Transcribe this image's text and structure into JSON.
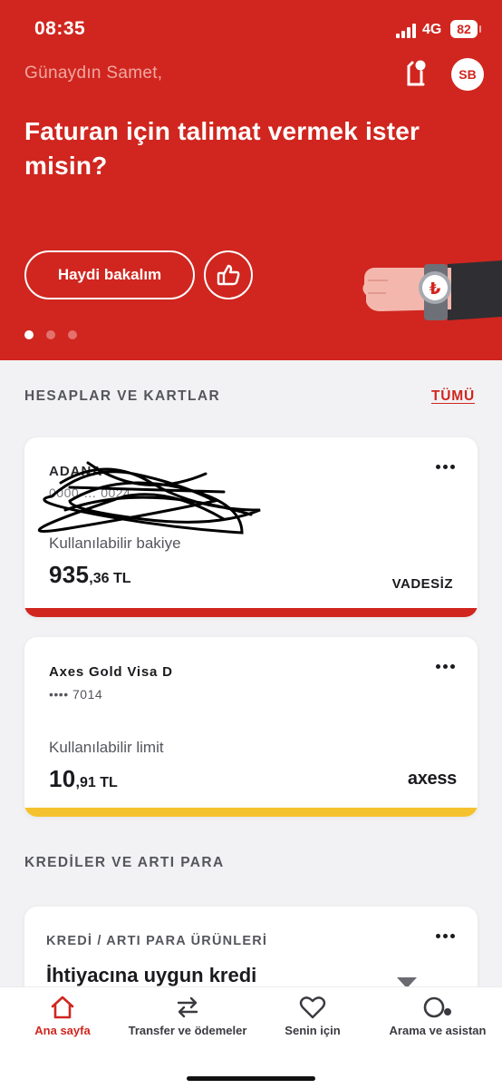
{
  "status_bar": {
    "time": "08:35",
    "network": "4G",
    "battery": "82"
  },
  "hero": {
    "greeting": "Günaydın Samet,",
    "avatar_initials": "SB",
    "headline": "Faturan için talimat vermek ister misin?",
    "cta_label": "Haydi bakalım",
    "carousel": {
      "count": 3,
      "active_index": 0
    }
  },
  "accounts_section": {
    "title": "HESAPLAR VE KARTLAR",
    "see_all": "TÜMÜ",
    "account": {
      "name": "ADANA",
      "number": "0000-… 0024",
      "balance_label": "Kullanılabilir bakiye",
      "balance_whole": "935",
      "balance_fraction": ",36 TL",
      "type": "VADESİZ",
      "accent_color": "#d0261f"
    },
    "card": {
      "name": "Axes Gold Visa D",
      "number": "•••• 7014",
      "limit_label": "Kullanılabilir limit",
      "limit_whole": "10",
      "limit_fraction": ",91 TL",
      "brand": "axess",
      "accent_color": "#f5c22f"
    }
  },
  "credits_section": {
    "title": "KREDİLER VE ARTI PARA",
    "card": {
      "subtitle": "KREDİ / ARTI PARA ÜRÜNLERİ",
      "title": "İhtiyacına uygun kredi"
    }
  },
  "tabbar": {
    "tabs": [
      {
        "label": "Ana sayfa",
        "icon": "home-icon",
        "active": true
      },
      {
        "label": "Transfer ve ödemeler",
        "icon": "transfer-icon",
        "active": false
      },
      {
        "label": "Senin için",
        "icon": "heart-icon",
        "active": false
      },
      {
        "label": "Arama ve asistan",
        "icon": "search-assistant-icon",
        "active": false
      }
    ]
  },
  "colors": {
    "brand_red": "#d0261f",
    "background": "#f2f2f4"
  }
}
